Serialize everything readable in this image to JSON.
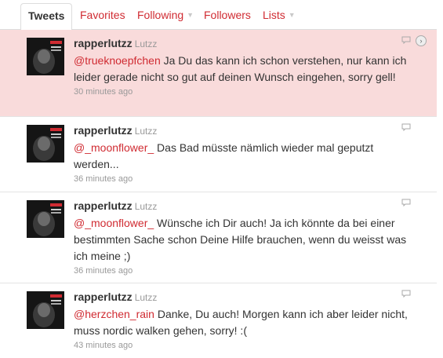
{
  "tabs": [
    {
      "label": "Tweets",
      "active": true
    },
    {
      "label": "Favorites"
    },
    {
      "label": "Following",
      "dropdown": true
    },
    {
      "label": "Followers"
    },
    {
      "label": "Lists",
      "dropdown": true
    }
  ],
  "colors": {
    "accent": "#d02b32",
    "highlight": "#f9dbdb",
    "muted": "#999999"
  },
  "tweets": [
    {
      "screen_name": "rapperlutzz",
      "full_name": "Lutzz",
      "mention": "@trueknoepfchen",
      "text": " Ja Du das kann ich schon verstehen, nur kann ich leider gerade nicht so gut auf deinen Wunsch eingehen, sorry gell!",
      "time": "30 minutes ago",
      "highlighted": true
    },
    {
      "screen_name": "rapperlutzz",
      "full_name": "Lutzz",
      "mention": "@_moonflower_",
      "text": " Das Bad müsste nämlich wieder mal geputzt werden...",
      "time": "36 minutes ago"
    },
    {
      "screen_name": "rapperlutzz",
      "full_name": "Lutzz",
      "mention": "@_moonflower_",
      "text": " Wünsche ich Dir auch! Ja ich könnte da bei einer bestimmten Sache schon Deine Hilfe brauchen, wenn du weisst was ich meine ;)",
      "time": "36 minutes ago"
    },
    {
      "screen_name": "rapperlutzz",
      "full_name": "Lutzz",
      "mention": "@herzchen_rain",
      "text": " Danke, Du auch! Morgen kann ich aber leider nicht, muss nordic walken gehen, sorry! :(",
      "time": "43 minutes ago"
    }
  ]
}
